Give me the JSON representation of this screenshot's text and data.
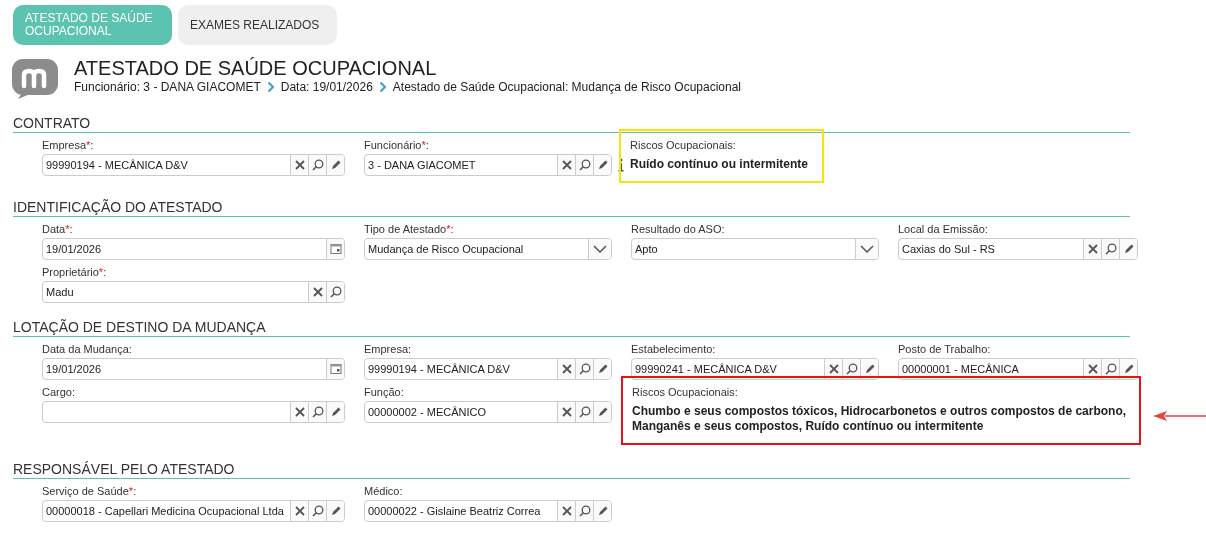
{
  "tabs": [
    {
      "label": "ATESTADO DE SAÚDE OCUPACIONAL",
      "selected": true
    },
    {
      "label": "EXAMES REALIZADOS",
      "selected": false
    }
  ],
  "header": {
    "title": "ATESTADO DE SAÚDE OCUPACIONAL",
    "breadcrumb": [
      "Funcionário: 3 - DANA GIACOMET",
      "Data: 19/01/2026",
      "Atestado de Saúde Ocupacional: Mudança de Risco Ocupacional"
    ]
  },
  "sections": [
    {
      "title": "CONTRATO",
      "rows": [
        [
          {
            "kind": "lookup",
            "label": "Empresa",
            "required_mark": "*",
            "label_end": ":",
            "value": "99990194 - MECÂNICA D&V",
            "editable": true,
            "info": false
          },
          {
            "kind": "lookup",
            "label": "Funcionário",
            "required_mark": "*",
            "label_end": ":",
            "value": "3 - DANA GIACOMET",
            "editable": true,
            "info": true
          },
          {
            "kind": "risks",
            "label": "Riscos Ocupacionais:",
            "value": "Ruído contínuo ou intermitente",
            "color": "#f5e50c",
            "wide": false,
            "arrow": false
          }
        ]
      ]
    },
    {
      "title": "IDENTIFICAÇÃO DO ATESTADO",
      "rows": [
        [
          {
            "kind": "date",
            "label": "Data",
            "required_mark": "*",
            "label_end": ":",
            "value": "19/01/2026"
          },
          {
            "kind": "select",
            "label": "Tipo de Atestado",
            "required_mark": "*",
            "label_end": ":",
            "value": "Mudança de Risco Ocupacional"
          },
          {
            "kind": "select",
            "label": "Resultado do ASO:",
            "value": "Apto"
          },
          {
            "kind": "lookup",
            "label": "Local da Emissão:",
            "value": "Caxias do Sul - RS",
            "editable": true,
            "info": false
          }
        ],
        [
          {
            "kind": "lookup",
            "label": "Proprietário",
            "required_mark": "*",
            "label_end": ":",
            "value": "Madu",
            "editable": false,
            "info": false
          }
        ]
      ]
    },
    {
      "title": "LOTAÇÃO DE DESTINO DA MUDANÇA",
      "rows": [
        [
          {
            "kind": "date",
            "label": "Data da Mudança:",
            "value": "19/01/2026"
          },
          {
            "kind": "lookup",
            "label": "Empresa:",
            "value": "99990194 - MECÂNICA D&V",
            "editable": true,
            "info": false
          },
          {
            "kind": "lookup",
            "label": "Estabelecimento:",
            "value": "99990241 - MECÂNICA D&V",
            "editable": true,
            "info": false
          },
          {
            "kind": "lookup",
            "label": "Posto de Trabalho:",
            "value": "00000001 - MECÂNICA",
            "editable": true,
            "info": false
          }
        ],
        [
          {
            "kind": "lookup",
            "label": "Cargo:",
            "editable": true,
            "info": false
          },
          {
            "kind": "lookup",
            "label": "Função:",
            "value": "00000002 - MECÂNICO",
            "editable": true,
            "info": false
          },
          {
            "kind": "risks",
            "label": "Riscos Ocupacionais:",
            "value": "Chumbo e seus compostos tóxicos, Hidrocarbonetos e outros compostos de carbono, Manganês e seus compostos, Ruído contínuo ou intermitente",
            "color": "#e3141b",
            "wide": true,
            "arrow": true
          }
        ]
      ]
    },
    {
      "title": "RESPONSÁVEL PELO ATESTADO",
      "rows": [
        [
          {
            "kind": "lookup",
            "label": "Serviço de Saúde",
            "required_mark": "*",
            "label_end": ":",
            "value": "00000018 - Capellari Medicina Ocupacional Ltda",
            "editable": true,
            "info": false
          },
          {
            "kind": "lookup",
            "label": "Médico:",
            "value": "00000022 - Gislaine Beatriz Correa",
            "editable": true,
            "info": false
          }
        ]
      ]
    }
  ]
}
